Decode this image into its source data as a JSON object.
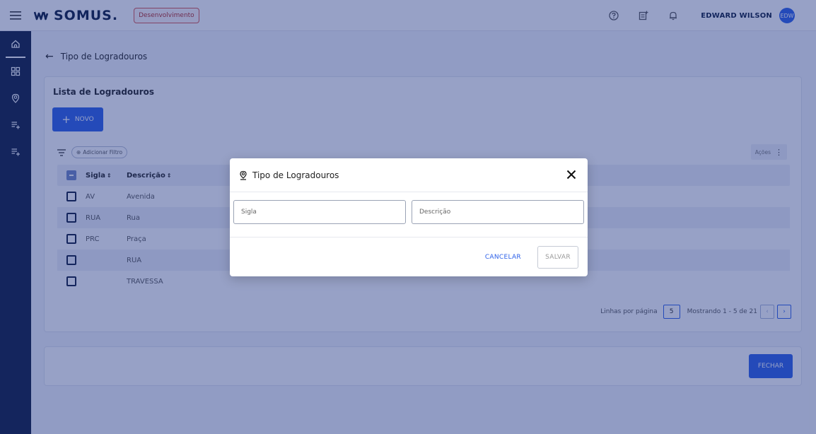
{
  "header": {
    "logo_text": "SOMUS.",
    "env_badge": "Desenvolvimento",
    "user_name": "EDWARD WILSON",
    "avatar_initials": "EDW"
  },
  "sidebar": {
    "items": [
      {
        "icon": "home-icon"
      },
      {
        "icon": "dashboard-icon"
      },
      {
        "icon": "location-icon"
      },
      {
        "icon": "list-add-icon"
      },
      {
        "icon": "list-add-icon"
      }
    ]
  },
  "page": {
    "title": "Tipo de Logradouros"
  },
  "list": {
    "title": "Lista de Logradouros",
    "new_label": "NOVO",
    "add_filter_label": "Adicionar Filtro",
    "actions_label": "Ações",
    "columns": [
      "Sigla",
      "Descrição"
    ],
    "rows": [
      {
        "sigla": "AV",
        "descricao": "Avenida"
      },
      {
        "sigla": "RUA",
        "descricao": "Rua"
      },
      {
        "sigla": "PRC",
        "descricao": "Praça"
      },
      {
        "sigla": "",
        "descricao": "RUA"
      },
      {
        "sigla": "",
        "descricao": "TRAVESSA"
      }
    ],
    "rows_per_page_label": "Linhas por página",
    "rows_per_page": "5",
    "showing_label": "Mostrando 1 - 5 de 21"
  },
  "footer": {
    "close_label": "FECHAR"
  },
  "modal": {
    "title": "Tipo de Logradouros",
    "sigla_placeholder": "Sigla",
    "descricao_placeholder": "Descrição",
    "cancel_label": "CANCELAR",
    "save_label": "SALVAR"
  },
  "colors": {
    "primary": "#2b5fe8",
    "sidebar": "#0d1b3e",
    "overlay": "#1c3282"
  }
}
